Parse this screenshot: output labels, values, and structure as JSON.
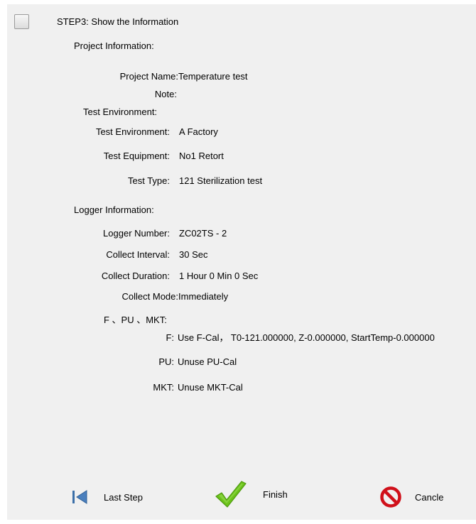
{
  "header": {
    "step_title": "STEP3:  Show the Information"
  },
  "project": {
    "section_label": "Project Information:",
    "name_label": "Project Name:",
    "name_value": "Temperature test",
    "note_label": "Note:",
    "note_value": "",
    "env_section_label": "Test Environment:",
    "env_label": "Test Environment:",
    "env_value": "A Factory",
    "equip_label": "Test Equipment:",
    "equip_value": "No1 Retort",
    "type_label": "Test Type:",
    "type_value": "121 Sterilization test"
  },
  "logger": {
    "section_label": "Logger Information:",
    "number_label": "Logger Number:",
    "number_value": "ZC02TS - 2",
    "interval_label": "Collect Interval:",
    "interval_value": "30 Sec",
    "duration_label": "Collect Duration:",
    "duration_value": "1 Hour 0 Min 0 Sec",
    "mode_label": "Collect Mode:",
    "mode_value": "Immediately"
  },
  "calc": {
    "section_label": "F 、PU 、MKT:",
    "f_label": "F:",
    "f_value": "Use F-Cal， T0-121.000000, Z-0.000000, StartTemp-0.000000",
    "pu_label": "PU:",
    "pu_value": "Unuse PU-Cal",
    "mkt_label": "MKT:",
    "mkt_value": "Unuse MKT-Cal"
  },
  "footer": {
    "last_step_label": "Last Step",
    "finish_label": "Finish",
    "cancel_label": "Cancle"
  },
  "colors": {
    "panel_bg": "#f0f0f0",
    "finish_green": "#6cc21a",
    "cancel_red": "#d0101a",
    "last_step_blue": "#3b6fa8"
  }
}
